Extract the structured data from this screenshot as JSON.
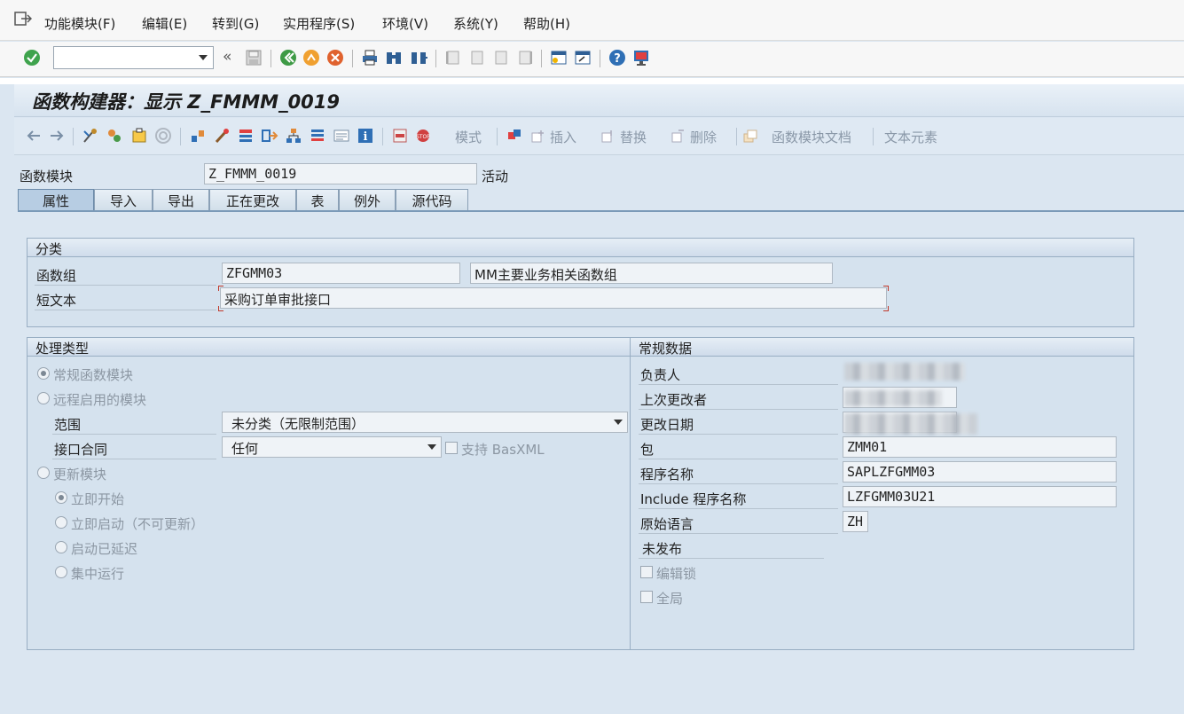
{
  "menu": {
    "items": [
      "功能模块(F)",
      "编辑(E)",
      "转到(G)",
      "实用程序(S)",
      "环境(V)",
      "系统(Y)",
      "帮助(H)"
    ]
  },
  "toolbar": {
    "command_value": ""
  },
  "title": "函数构建器：显示 Z_FMMM_0019",
  "appbar": {
    "mode_label": "模式",
    "insert_label": "插入",
    "replace_label": "替换",
    "delete_label": "删除",
    "fm_doc_label": "函数模块文档",
    "text_elements_label": "文本元素"
  },
  "header": {
    "fm_label": "函数模块",
    "fm_value": "Z_FMMM_0019",
    "status": "活动"
  },
  "tabs": [
    "属性",
    "导入",
    "导出",
    "正在更改",
    "表",
    "例外",
    "源代码"
  ],
  "classification": {
    "title": "分类",
    "group_label": "函数组",
    "group_value": "ZFGMM03",
    "group_desc": "MM主要业务相关函数组",
    "short_text_label": "短文本",
    "short_text_value": "采购订单审批接口"
  },
  "processing": {
    "title": "处理类型",
    "normal": "常规函数模块",
    "remote": "远程启用的模块",
    "scope_label": "范围",
    "scope_value": "未分类（无限制范围）",
    "contract_label": "接口合同",
    "contract_value": "任何",
    "basxml_label": "支持 BasXML",
    "update": "更新模块",
    "start_immediately": "立即开始",
    "start_immediately_no_update": "立即启动（不可更新）",
    "start_delayed": "启动已延迟",
    "collective_run": "集中运行"
  },
  "general": {
    "title": "常规数据",
    "owner_label": "负责人",
    "last_changed_by_label": "上次更改者",
    "changed_on_label": "更改日期",
    "package_label": "包",
    "package_value": "ZMM01",
    "program_label": "程序名称",
    "program_value": "SAPLZFGMM03",
    "include_label": "Include 程序名称",
    "include_value": "LZFGMM03U21",
    "lang_label": "原始语言",
    "lang_value": "ZH",
    "not_released": "未发布",
    "edit_lock": "编辑锁",
    "global": "全局"
  }
}
